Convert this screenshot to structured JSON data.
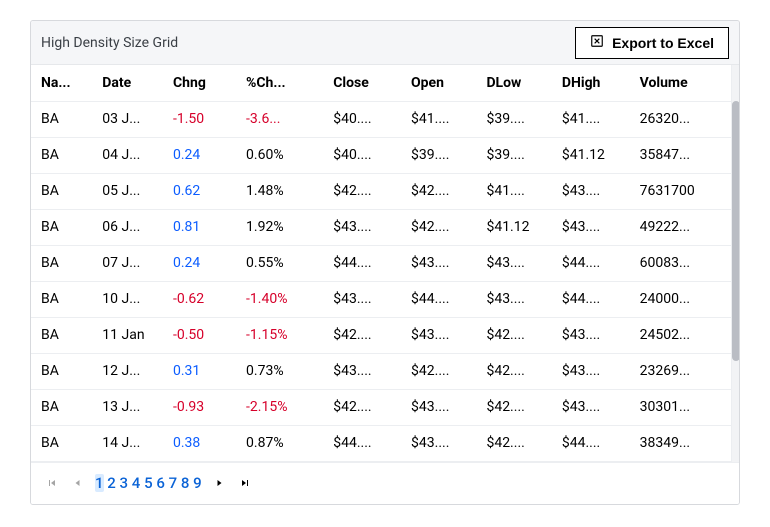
{
  "header": {
    "title": "High Density Size Grid",
    "export_label": "Export to Excel"
  },
  "columns": [
    "Na...",
    "Date",
    "Chng",
    "%Ch...",
    "Close",
    "Open",
    "DLow",
    "DHigh",
    "Volume"
  ],
  "rows": [
    {
      "name": "BA",
      "date": "03 J...",
      "chng": "-1.50",
      "chng_dir": "neg",
      "pct": "-3.6...",
      "pct_dir": "neg",
      "close": "$40....",
      "open": "$41....",
      "dlow": "$39....",
      "dhigh": "$41....",
      "vol": "26320..."
    },
    {
      "name": "BA",
      "date": "04 J...",
      "chng": "0.24",
      "chng_dir": "pos",
      "pct": "0.60%",
      "pct_dir": "",
      "close": "$40....",
      "open": "$39....",
      "dlow": "$39....",
      "dhigh": "$41.12",
      "vol": "35847..."
    },
    {
      "name": "BA",
      "date": "05 J...",
      "chng": "0.62",
      "chng_dir": "pos",
      "pct": "1.48%",
      "pct_dir": "",
      "close": "$42....",
      "open": "$42....",
      "dlow": "$41....",
      "dhigh": "$43....",
      "vol": "7631700"
    },
    {
      "name": "BA",
      "date": "06 J...",
      "chng": "0.81",
      "chng_dir": "pos",
      "pct": "1.92%",
      "pct_dir": "",
      "close": "$43....",
      "open": "$42....",
      "dlow": "$41.12",
      "dhigh": "$43....",
      "vol": "49222..."
    },
    {
      "name": "BA",
      "date": "07 J...",
      "chng": "0.24",
      "chng_dir": "pos",
      "pct": "0.55%",
      "pct_dir": "",
      "close": "$44....",
      "open": "$43....",
      "dlow": "$43....",
      "dhigh": "$44....",
      "vol": "60083..."
    },
    {
      "name": "BA",
      "date": "10 J...",
      "chng": "-0.62",
      "chng_dir": "neg",
      "pct": "-1.40%",
      "pct_dir": "neg",
      "close": "$43....",
      "open": "$44....",
      "dlow": "$43....",
      "dhigh": "$44....",
      "vol": "24000..."
    },
    {
      "name": "BA",
      "date": "11 Jan",
      "chng": "-0.50",
      "chng_dir": "neg",
      "pct": "-1.15%",
      "pct_dir": "neg",
      "close": "$42....",
      "open": "$43....",
      "dlow": "$42....",
      "dhigh": "$43....",
      "vol": "24502..."
    },
    {
      "name": "BA",
      "date": "12 J...",
      "chng": "0.31",
      "chng_dir": "pos",
      "pct": "0.73%",
      "pct_dir": "",
      "close": "$43....",
      "open": "$42....",
      "dlow": "$42....",
      "dhigh": "$43....",
      "vol": "23269..."
    },
    {
      "name": "BA",
      "date": "13 J...",
      "chng": "-0.93",
      "chng_dir": "neg",
      "pct": "-2.15%",
      "pct_dir": "neg",
      "close": "$42....",
      "open": "$43....",
      "dlow": "$42....",
      "dhigh": "$43....",
      "vol": "30301..."
    },
    {
      "name": "BA",
      "date": "14 J...",
      "chng": "0.38",
      "chng_dir": "pos",
      "pct": "0.87%",
      "pct_dir": "",
      "close": "$44....",
      "open": "$43....",
      "dlow": "$42....",
      "dhigh": "$44....",
      "vol": "38349..."
    }
  ],
  "pager": {
    "pages": [
      "1",
      "2",
      "3",
      "4",
      "5",
      "6",
      "7",
      "8",
      "9"
    ],
    "current": "1"
  }
}
